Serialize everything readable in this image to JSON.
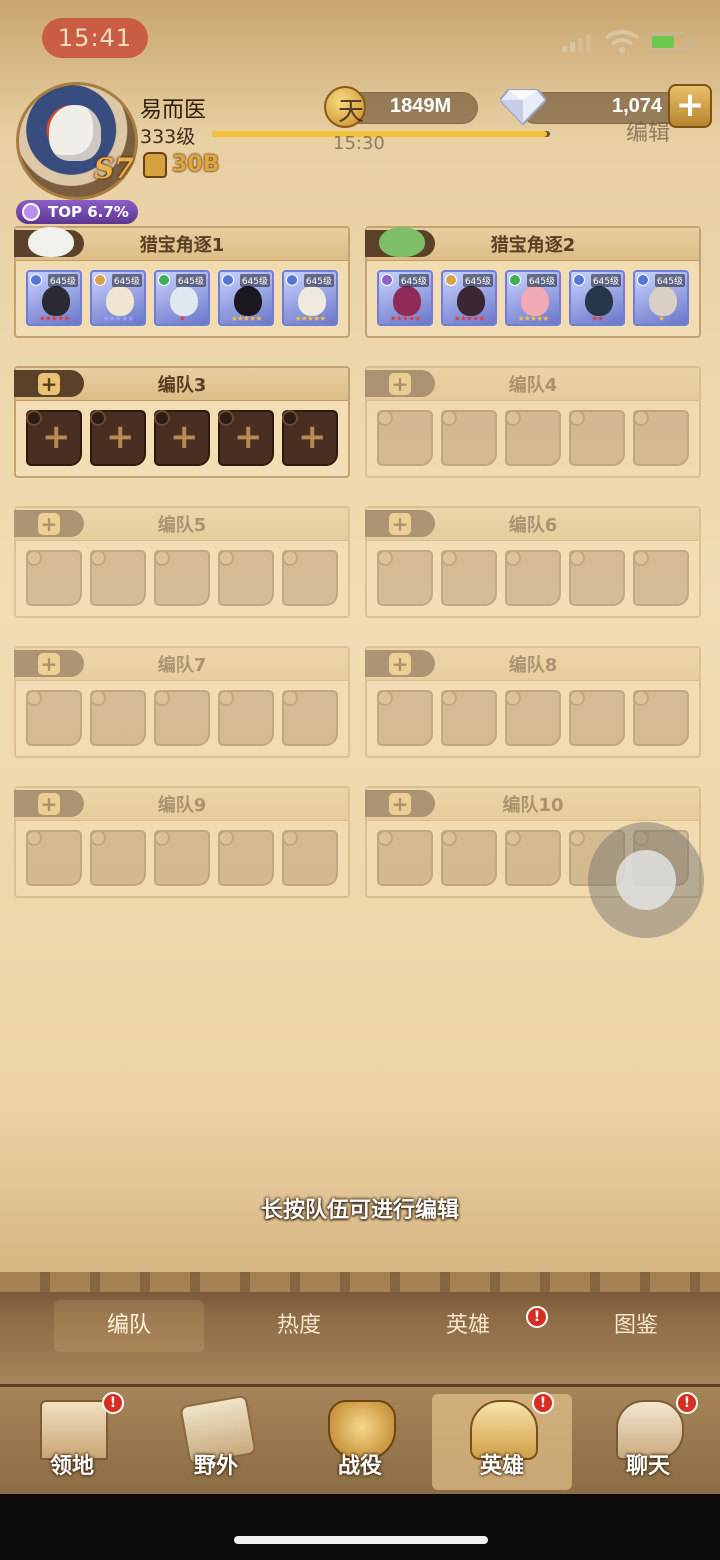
{
  "status_bar": {
    "time": "15:41"
  },
  "player": {
    "name": "易而医",
    "level": "333级",
    "season": "S7",
    "power": "30B",
    "rank": "TOP 6.7%",
    "xp_progress": 0.99
  },
  "currency": {
    "gold": "1849M",
    "gems": "1,074",
    "overlay_char": "天",
    "ghost_edit": "编辑",
    "ghost_time": "15:30"
  },
  "teams": [
    {
      "name": "猎宝角逐1",
      "heroes": [
        {
          "level": "645级",
          "stars": "★★★★★",
          "star_color": "#e0403a",
          "face": "#2b2a33",
          "faction": "#4e7ad6"
        },
        {
          "level": "645级",
          "stars": "★★★★★",
          "star_color": "#9aa7f0",
          "face": "#efe5d2",
          "faction": "#d6a34a"
        },
        {
          "level": "645级",
          "stars": "★",
          "star_color": "#e0403a",
          "face": "#dfe7ef",
          "faction": "#3fae55"
        },
        {
          "level": "645级",
          "stars": "★★★★★",
          "star_color": "#f2c040",
          "face": "#1c1820",
          "faction": "#4e7ad6"
        },
        {
          "level": "645级",
          "stars": "★★★★★",
          "star_color": "#f2c040",
          "face": "#efe9e0",
          "faction": "#4e7ad6"
        }
      ]
    },
    {
      "name": "猎宝角逐2",
      "heroes": [
        {
          "level": "645级",
          "stars": "★★★★★",
          "star_color": "#e0403a",
          "face": "#8f2b56",
          "faction": "#8b5fc7"
        },
        {
          "level": "645级",
          "stars": "★★★★★",
          "star_color": "#e0403a",
          "face": "#3b2633",
          "faction": "#d6a34a"
        },
        {
          "level": "645级",
          "stars": "★★★★★",
          "star_color": "#f2c040",
          "face": "#f1a9b6",
          "faction": "#3fae55"
        },
        {
          "level": "645级",
          "stars": "★★",
          "star_color": "#e0403a",
          "face": "#273649",
          "faction": "#4e7ad6"
        },
        {
          "level": "645级",
          "stars": "★",
          "star_color": "#f2c040",
          "face": "#d9cfc5",
          "faction": "#4e7ad6"
        }
      ]
    },
    {
      "name": "编队3"
    },
    {
      "name": "编队4"
    },
    {
      "name": "编队5"
    },
    {
      "name": "编队6"
    },
    {
      "name": "编队7"
    },
    {
      "name": "编队8"
    },
    {
      "name": "编队9"
    },
    {
      "name": "编队10"
    }
  ],
  "hint": "长按队伍可进行编辑",
  "sub_tabs": [
    "编队",
    "热度",
    "英雄",
    "图鉴"
  ],
  "bottom_nav": [
    "领地",
    "野外",
    "战役",
    "英雄",
    "聊天"
  ],
  "colors": {
    "accent_gold": "#e0a63a",
    "alert_red": "#d72e1f",
    "rank_purple": "#6a43a6"
  }
}
